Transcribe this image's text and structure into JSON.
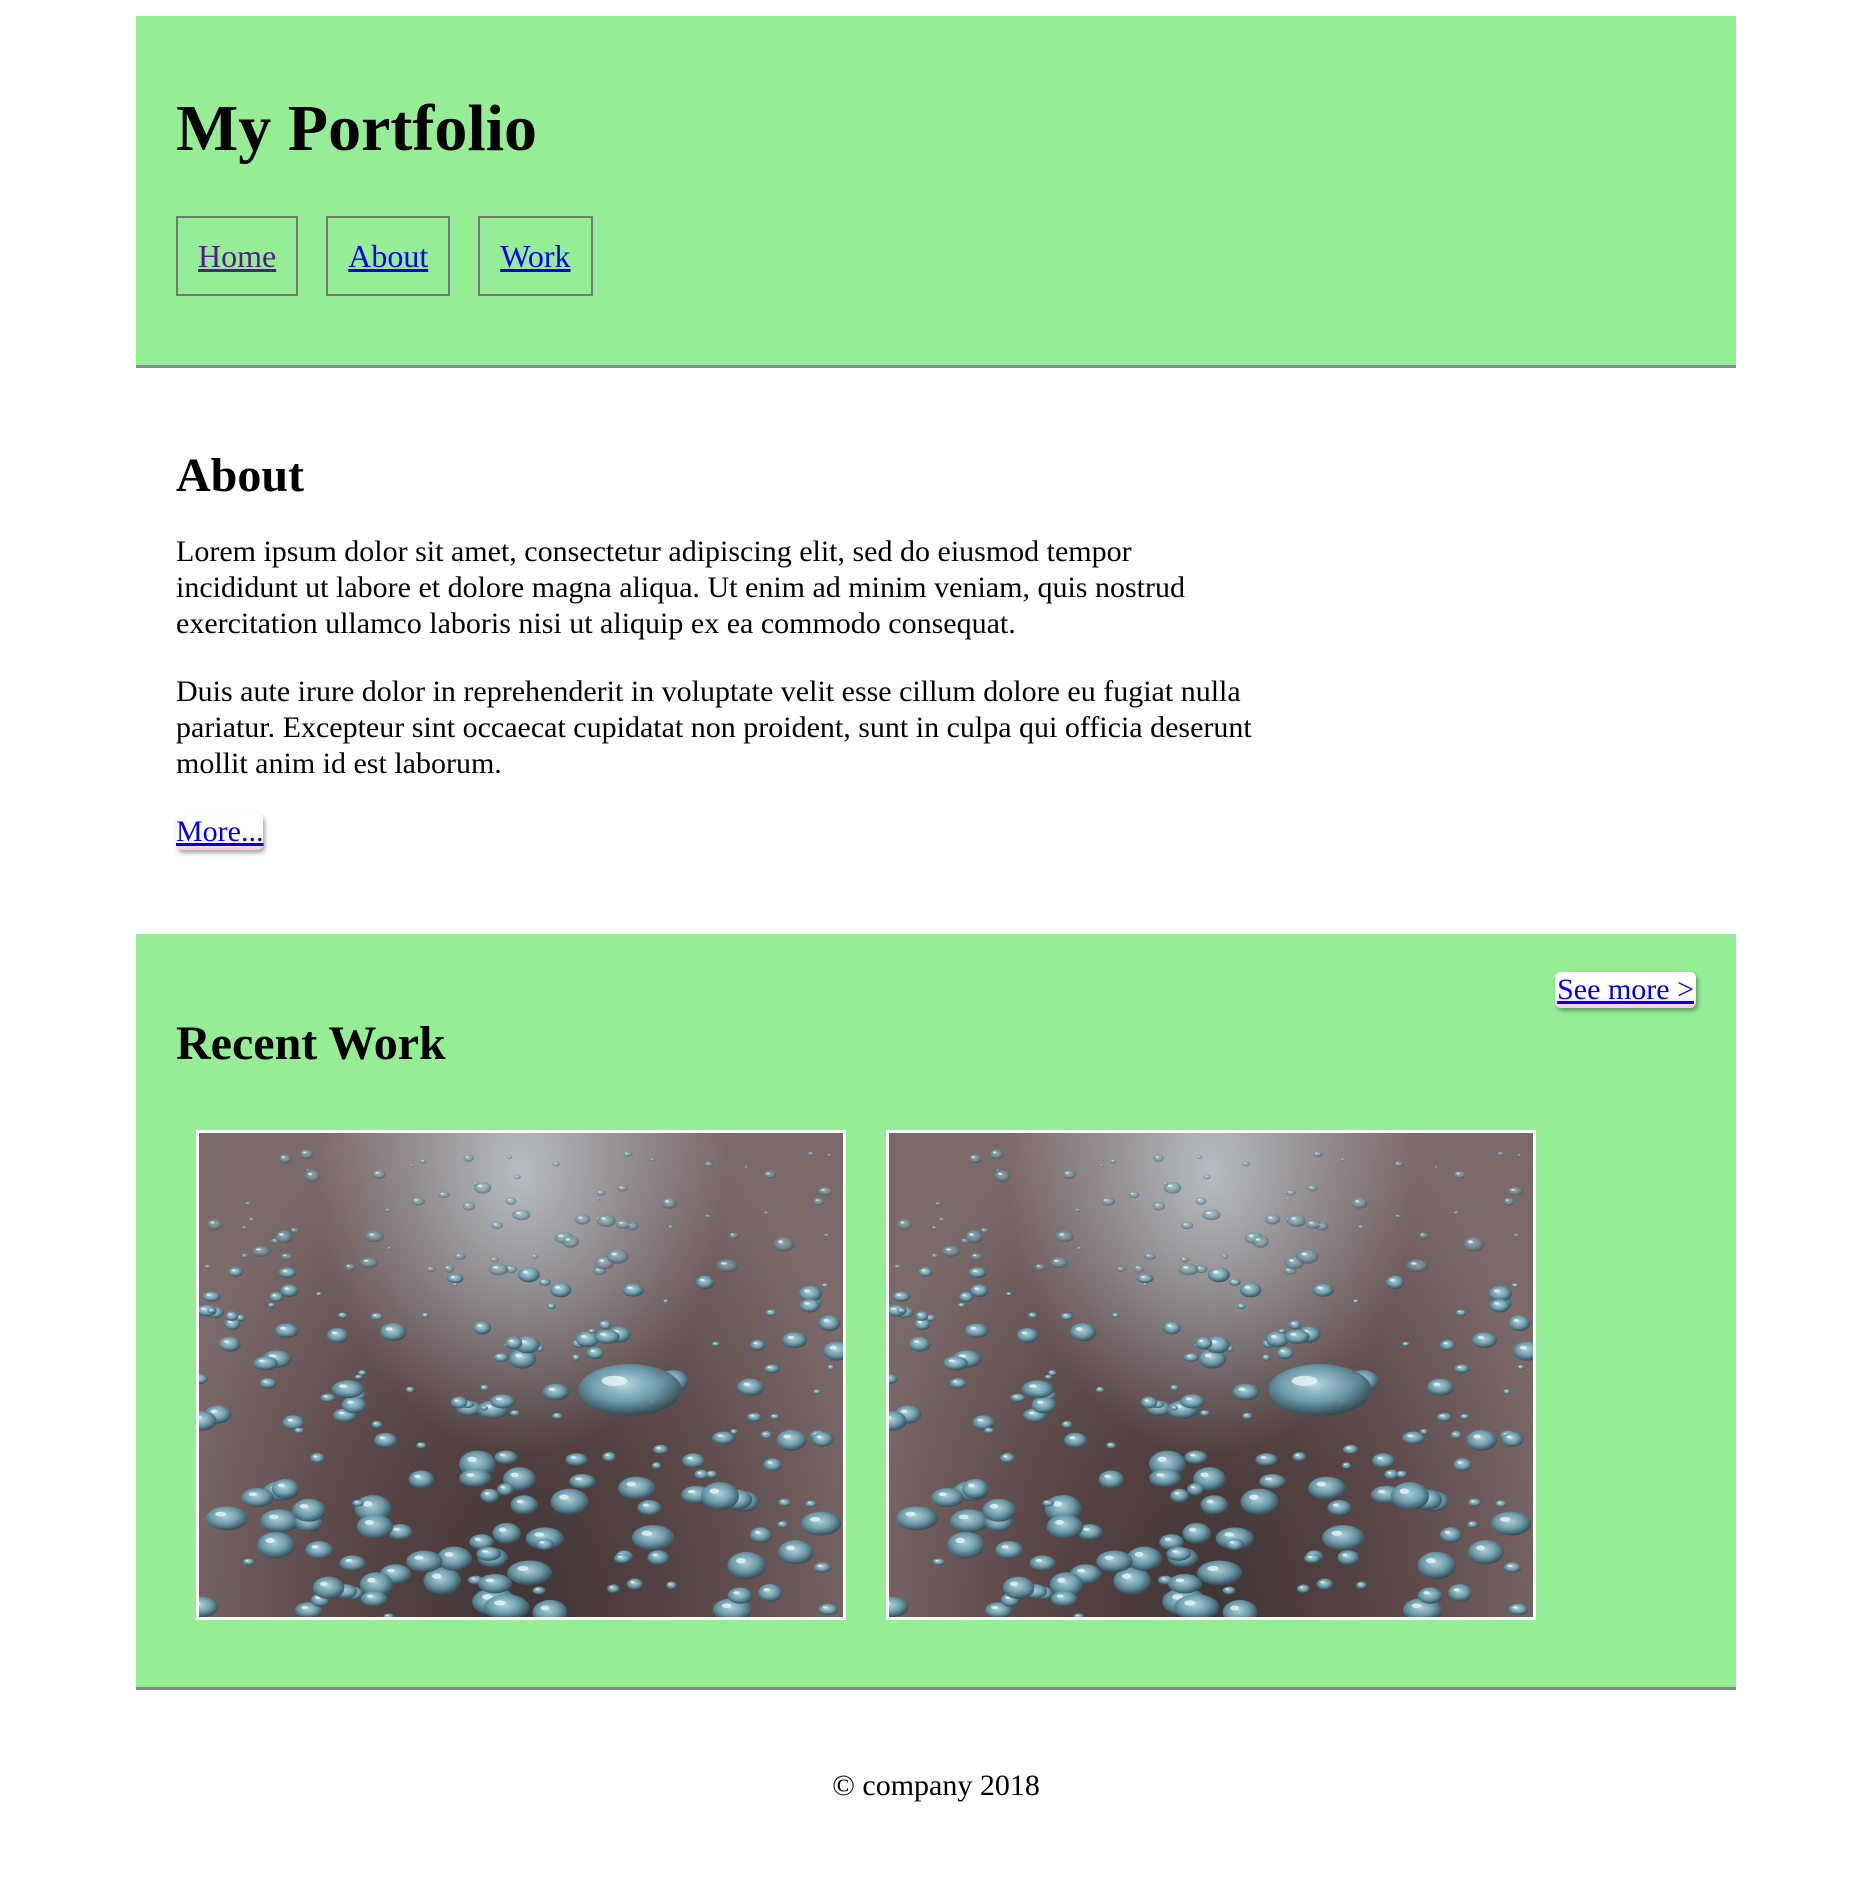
{
  "header": {
    "title": "My Portfolio",
    "nav": [
      {
        "label": "Home"
      },
      {
        "label": "About"
      },
      {
        "label": "Work"
      }
    ],
    "background": "#95ee95"
  },
  "about": {
    "title": "About",
    "paragraphs": [
      "Lorem ipsum dolor sit amet, consectetur adipiscing elit, sed do eiusmod tempor incididunt ut labore et dolore magna aliqua. Ut enim ad minim veniam, quis nostrud exercitation ullamco laboris nisi ut aliquip ex ea commodo consequat.",
      "Duis aute irure dolor in reprehenderit in voluptate velit esse cillum dolore eu fugiat nulla pariatur. Excepteur sint occaecat cupidatat non proident, sunt in culpa qui officia deserunt mollit anim id est laborum."
    ],
    "more_label": "More..."
  },
  "work": {
    "title": "Recent Work",
    "see_more_label": "See more >",
    "background": "#95ee95"
  },
  "footer": {
    "copyright": "© company 2018"
  }
}
